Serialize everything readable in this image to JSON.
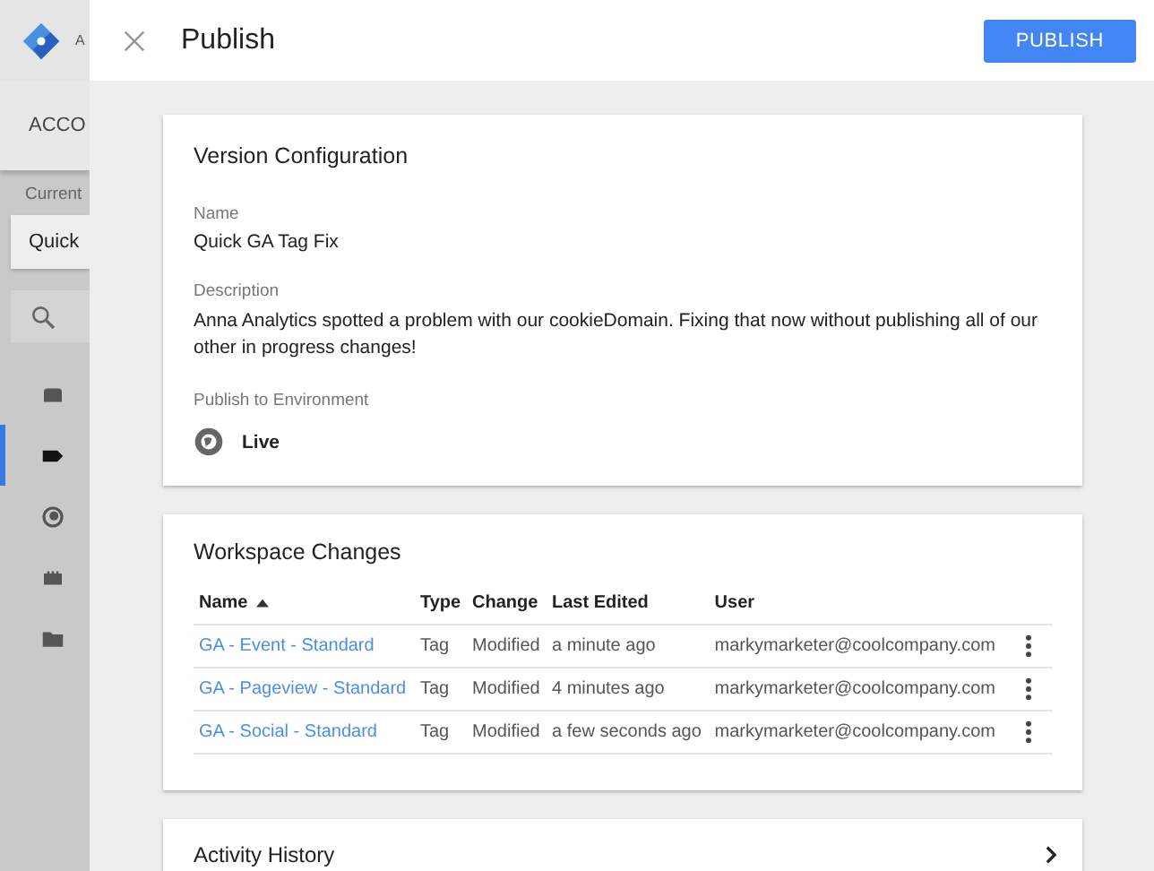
{
  "background": {
    "app_label": "A",
    "tab": "ACCO",
    "current_label": "Current",
    "workspace": "Quick",
    "sidebar_items": [
      {
        "selected": false
      },
      {
        "selected": true
      },
      {
        "selected": false
      },
      {
        "selected": false
      },
      {
        "selected": false
      }
    ]
  },
  "panel": {
    "title": "Publish",
    "publish_button": "PUBLISH",
    "version": {
      "heading": "Version Configuration",
      "name_label": "Name",
      "name": "Quick GA Tag Fix",
      "description_label": "Description",
      "description": "Anna Analytics spotted a problem with our cookieDomain. Fixing that now without publishing all of our other in progress changes!",
      "environment_label": "Publish to Environment",
      "environment": "Live"
    },
    "changes": {
      "heading": "Workspace Changes",
      "columns": [
        "Name",
        "Type",
        "Change",
        "Last Edited",
        "User"
      ],
      "rows": [
        {
          "name": "GA - Event - Standard",
          "type": "Tag",
          "change": "Modified",
          "last_edited": "a minute ago",
          "user": "markymarketer@coolcompany.com"
        },
        {
          "name": "GA - Pageview - Standard",
          "type": "Tag",
          "change": "Modified",
          "last_edited": "4 minutes ago",
          "user": "markymarketer@coolcompany.com"
        },
        {
          "name": "GA - Social - Standard",
          "type": "Tag",
          "change": "Modified",
          "last_edited": "a few seconds ago",
          "user": "markymarketer@coolcompany.com"
        }
      ]
    },
    "activity": {
      "heading": "Activity History"
    }
  }
}
